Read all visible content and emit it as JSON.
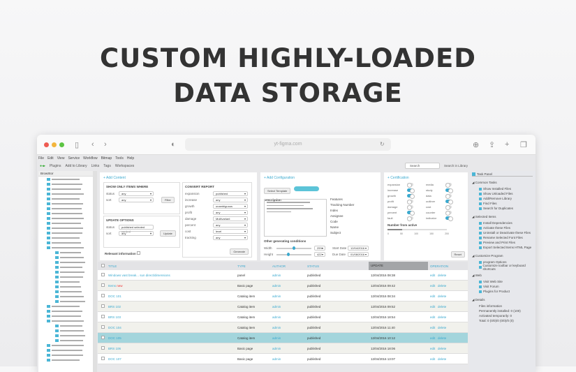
{
  "headline": [
    "CUSTOM HIGHLY-LOADED",
    "DATA STORAGE"
  ],
  "browser": {
    "url": "yt-figma.com"
  },
  "menu": [
    "File",
    "Edit",
    "View",
    "Service",
    "Workflow",
    "Bitmap",
    "Tools",
    "Help"
  ],
  "toolbar": {
    "items": [
      "Plugins",
      "Add to Library",
      "Links",
      "Tags",
      "Workspaces"
    ],
    "search_placeholder": "Search",
    "library": "Search in Library"
  },
  "sidebar": {
    "title": "BrowStor"
  },
  "add_content": {
    "title": "+ Add Content",
    "box1": {
      "title": "SHOW ONLY ITEMS WHERE",
      "fields": [
        {
          "label": "status",
          "value": "any"
        },
        {
          "label": "sort",
          "value": "any"
        }
      ],
      "button": "Filter"
    },
    "box2": {
      "title": "UPDATE OPTIONS",
      "fields": [
        {
          "label": "status",
          "value": "published selected content"
        },
        {
          "label": "sort",
          "value": "any"
        }
      ],
      "button": "Update"
    },
    "report": {
      "title": "CONVERT REPORT",
      "fields": [
        {
          "label": "expansion",
          "value": "published"
        },
        {
          "label": "increase",
          "value": "any"
        },
        {
          "label": "growth",
          "value": "unambiguous"
        },
        {
          "label": "profit",
          "value": "any"
        },
        {
          "label": "damage",
          "value": "Multivariant"
        },
        {
          "label": "percent",
          "value": "any"
        },
        {
          "label": "cost",
          "value": "level"
        },
        {
          "label": "tracking",
          "value": "any"
        }
      ],
      "button": "Generate"
    },
    "relevant": "Relevant information"
  },
  "configuration": {
    "title": "+ Add Configuration",
    "select": "Select Template",
    "description": "Description",
    "props": [
      "Features",
      "Tracking Number",
      "Index",
      "Assignee",
      "Code",
      "Name",
      "Subject"
    ],
    "other": "Other generating conditions",
    "sliders": [
      {
        "label": "Width",
        "value": "25%",
        "fraction": 0.45
      },
      {
        "label": "Height",
        "value": "422",
        "fraction": 0.3
      }
    ],
    "start_label": "Start Date",
    "start": "12/04/2016",
    "end_label": "Due Date",
    "end": "01/08/2016"
  },
  "certification": {
    "title": "+ Certification",
    "toggles": [
      {
        "label": "expansion",
        "on": false
      },
      {
        "label": "media",
        "on": false
      },
      {
        "label": "increase",
        "on": true
      },
      {
        "label": "study",
        "on": true
      },
      {
        "label": "growth",
        "on": true
      },
      {
        "label": "data",
        "on": false
      },
      {
        "label": "profit",
        "on": false
      },
      {
        "label": "outliner",
        "on": true
      },
      {
        "label": "damage",
        "on": false
      },
      {
        "label": "cost",
        "on": false
      },
      {
        "label": "percent",
        "on": true
      },
      {
        "label": "counter",
        "on": false
      },
      {
        "label": "fault",
        "on": false
      },
      {
        "label": "indicator",
        "on": true
      }
    ],
    "slider_title": "Number from active",
    "ticks": [
      "0",
      "50",
      "100",
      "150",
      "200"
    ],
    "button": "Reset"
  },
  "table": {
    "headers": [
      "TITLE",
      "TYPE",
      "AUTHOR",
      "STATUS",
      "UPDATE",
      "OPERATION"
    ],
    "rows": [
      {
        "title": "Windows vast break... sun direct/dimensions",
        "type": "panel",
        "author": "admin",
        "status": "published",
        "date": "12/04/2016 08:38",
        "selected": false
      },
      {
        "title": "Items",
        "badge": "new",
        "type": "Basic page",
        "author": "admin",
        "status": "published",
        "date": "12/04/2016 09:42",
        "selected": false
      },
      {
        "title": "DOC 101",
        "type": "Catalog item",
        "author": "admin",
        "status": "published",
        "date": "12/04/2016 08:34",
        "selected": false
      },
      {
        "title": "BRS 102",
        "type": "Catalog item",
        "author": "admin",
        "status": "published",
        "date": "12/04/2016 09:52",
        "selected": false
      },
      {
        "title": "BRS 103",
        "type": "Catalog item",
        "author": "admin",
        "status": "published",
        "date": "12/04/2016 18:54",
        "selected": false
      },
      {
        "title": "DOC 104",
        "type": "Catalog item",
        "author": "admin",
        "status": "published",
        "date": "12/04/2016 11:40",
        "selected": false
      },
      {
        "title": "DOC 105",
        "type": "Catalog item",
        "author": "admin",
        "status": "published",
        "date": "12/04/2016 10:12",
        "selected": true
      },
      {
        "title": "BRS 106",
        "type": "Basic page",
        "author": "admin",
        "status": "published",
        "date": "12/04/2016 18:06",
        "selected": false
      },
      {
        "title": "DOC 107",
        "type": "Basic page",
        "author": "admin",
        "status": "published",
        "date": "12/04/2016 13:07",
        "selected": false
      }
    ],
    "ops": [
      "edit",
      "delete"
    ]
  },
  "task_panel": {
    "title": "Task Panel",
    "sections": [
      {
        "title": "Common Tasks",
        "items": [
          "Show Installed Files",
          "Show Unloaded Files",
          "Add/Remove Library",
          "Find Files",
          "Search for Duplicates"
        ]
      },
      {
        "title": "Selected Items",
        "items": [
          "Install Dependencies",
          "Activate these Files",
          "Uninstall or Deactivate these Files",
          "Rename Selected Font Files",
          "Preview and Print Files",
          "Export Selected Items HTML Page"
        ]
      },
      {
        "title": "Customize Program",
        "items": [
          "program Options",
          "Customize toolbar or keyboard shortcuts"
        ]
      },
      {
        "title": "Web",
        "items": [
          "Visit Web Site",
          "Visit Forum",
          "Plugins for Product"
        ]
      },
      {
        "title": "Details",
        "items": [
          "Files information",
          "Permanently installed: 0 (100)",
          "Activated temporarily: 0",
          "Total: 0 (0/0)/0 (0/0)/0 (0)"
        ]
      }
    ]
  }
}
